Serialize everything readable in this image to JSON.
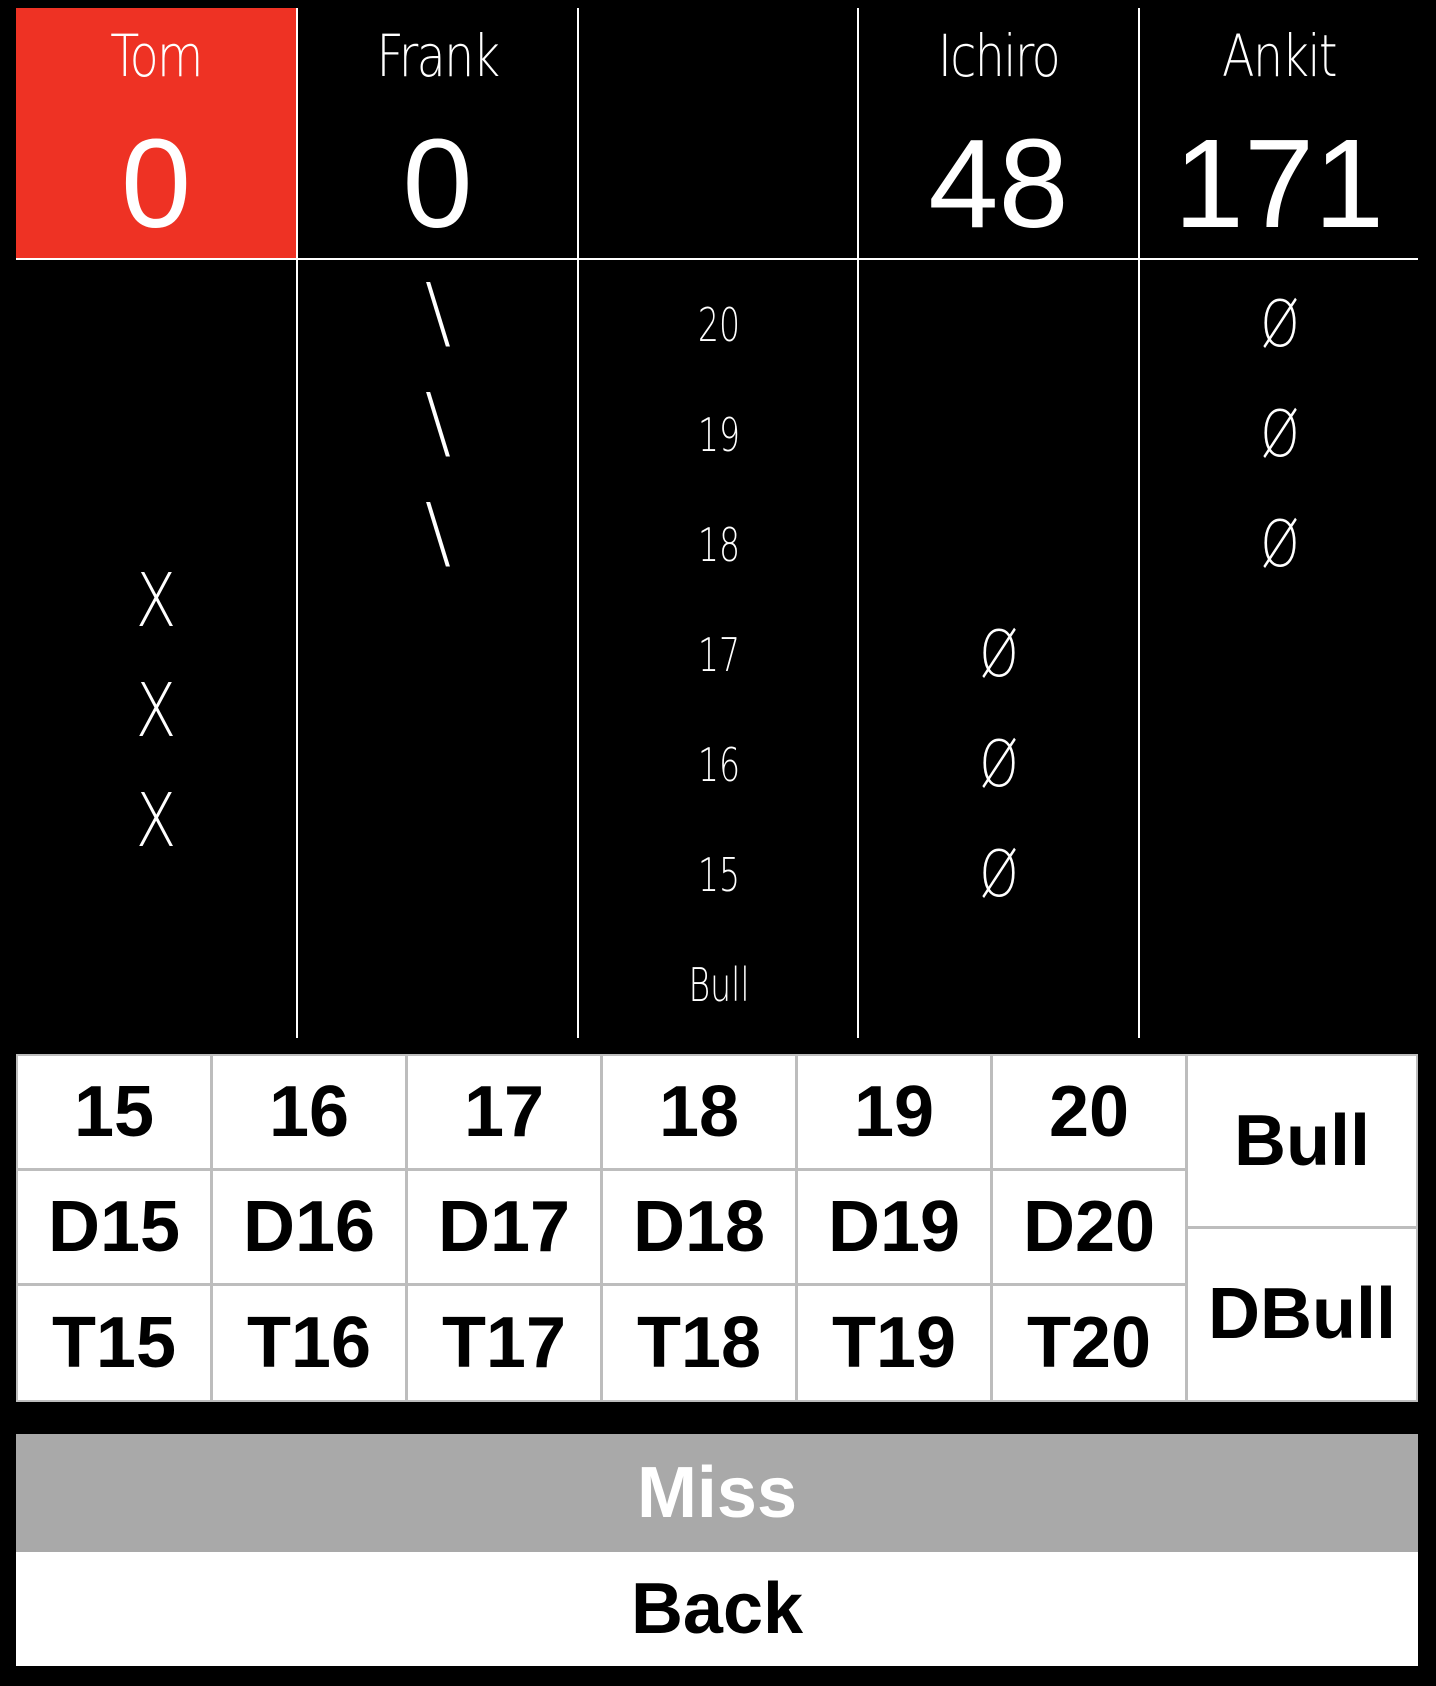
{
  "players": [
    {
      "name": "Tom",
      "score": "0",
      "active": true
    },
    {
      "name": "Frank",
      "score": "0",
      "active": false
    },
    {
      "name": "",
      "score": "",
      "active": false
    },
    {
      "name": "Ichiro",
      "score": "48",
      "active": false
    },
    {
      "name": "Ankit",
      "score": "171",
      "active": false
    }
  ],
  "targets": [
    "20",
    "19",
    "18",
    "17",
    "16",
    "15",
    "Bull"
  ],
  "marks": {
    "tom": [
      "",
      "",
      "",
      "X",
      "X",
      "X",
      ""
    ],
    "frank": [
      "\\",
      "\\",
      "\\",
      "",
      "",
      "",
      ""
    ],
    "ichiro": [
      "",
      "",
      "",
      "Ø",
      "Ø",
      "Ø",
      ""
    ],
    "ankit": [
      "Ø",
      "Ø",
      "Ø",
      "",
      "",
      "",
      ""
    ]
  },
  "keypad": {
    "singles": [
      "15",
      "16",
      "17",
      "18",
      "19",
      "20"
    ],
    "doubles": [
      "D15",
      "D16",
      "D17",
      "D18",
      "D19",
      "D20"
    ],
    "triples": [
      "T15",
      "T16",
      "T17",
      "T18",
      "T19",
      "T20"
    ],
    "bull": "Bull",
    "dbull": "DBull"
  },
  "actions": {
    "miss": "Miss",
    "back": "Back"
  },
  "colors": {
    "active_player": "#ee3224",
    "background": "#000000",
    "miss_button": "#a9a9a9"
  }
}
